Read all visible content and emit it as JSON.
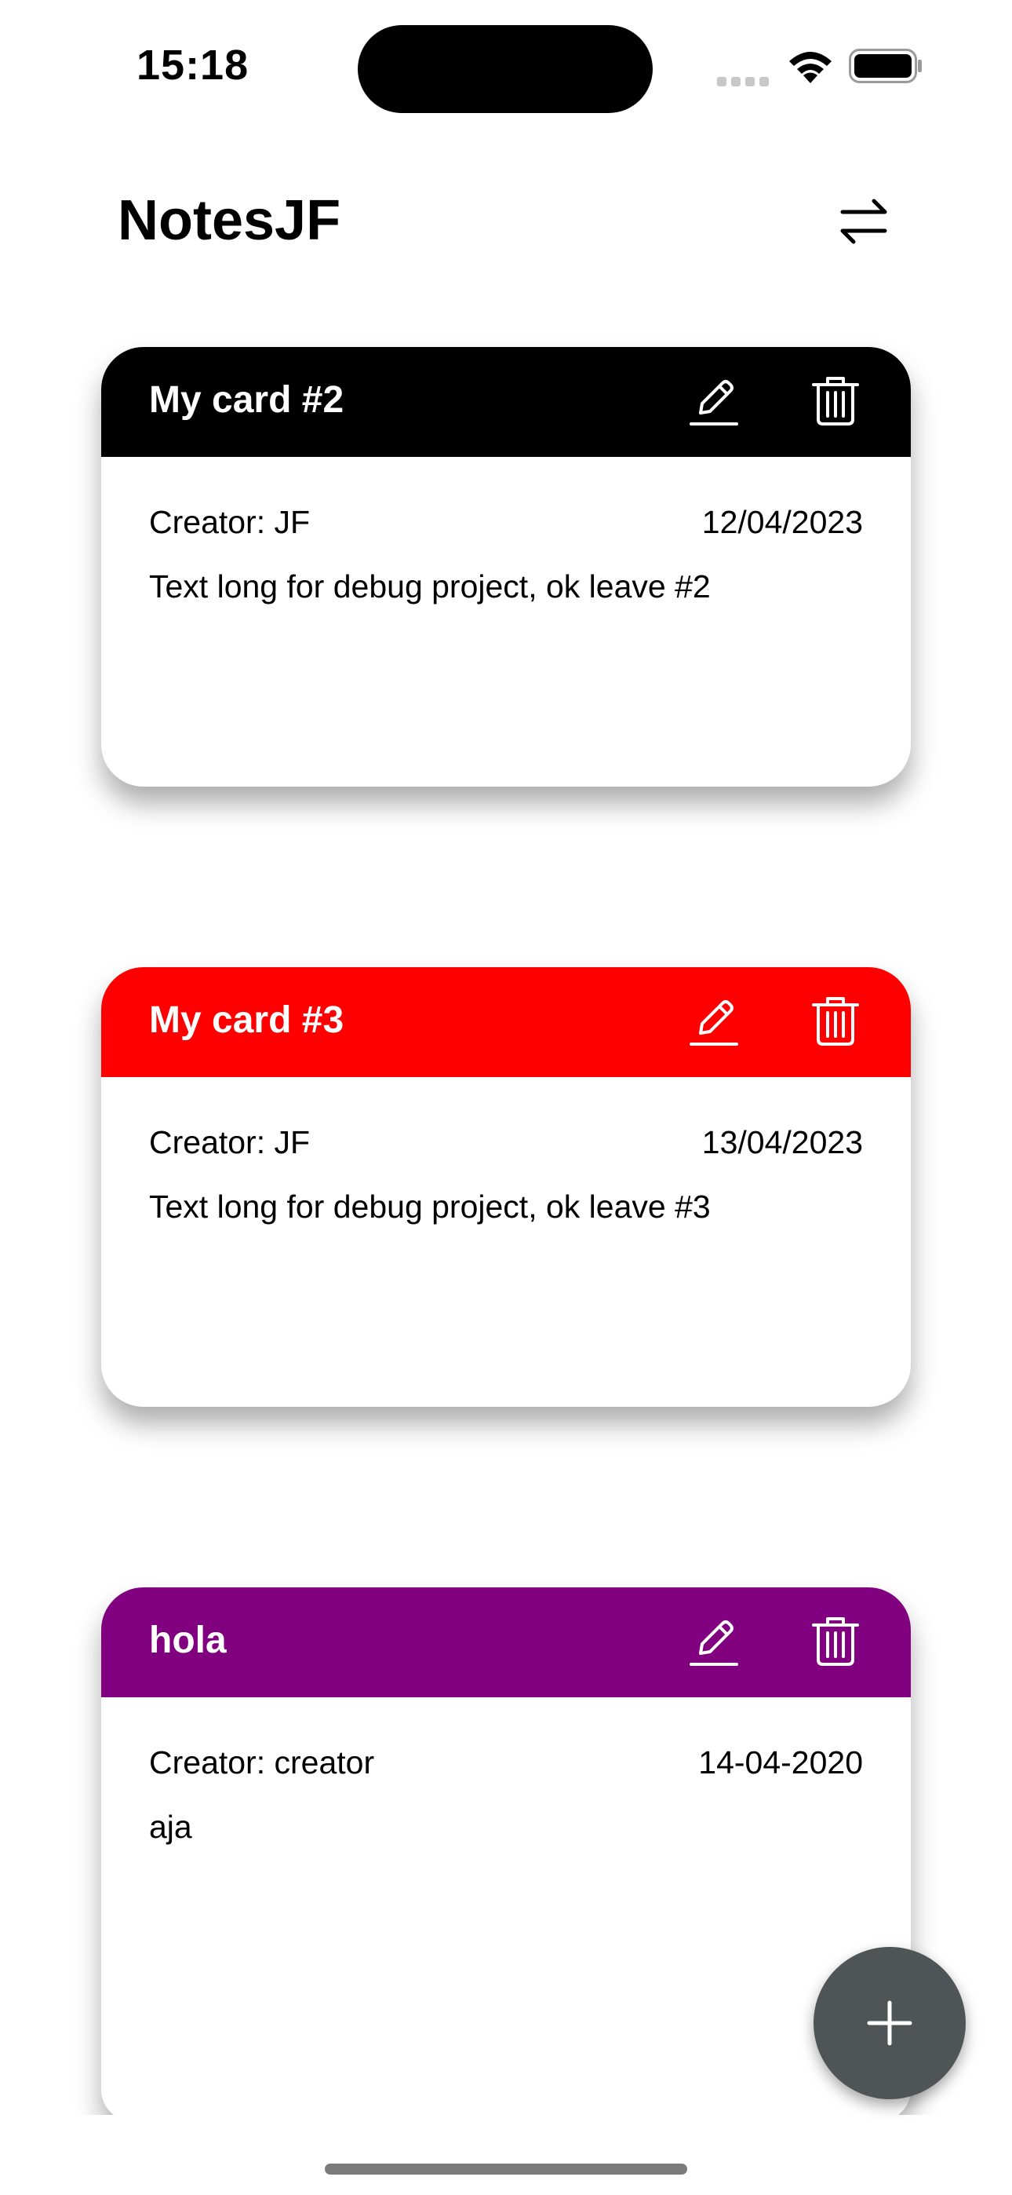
{
  "status_bar": {
    "time": "15:18"
  },
  "header": {
    "title": "NotesJF",
    "sort_icon": "swap-arrows-icon"
  },
  "colors": {
    "card_2": "#000000",
    "card_3": "#ff0000",
    "card_hola": "#800080",
    "fab": "#4f5556"
  },
  "cards": [
    {
      "title": "My card #2",
      "creator": "Creator: JF",
      "date": "12/04/2023",
      "text": "Text long for debug project, ok leave #2",
      "color": "#000000"
    },
    {
      "title": "My card #3",
      "creator": "Creator: JF",
      "date": "13/04/2023",
      "text": "Text long for debug project, ok leave #3",
      "color": "#ff0000"
    },
    {
      "title": "hola",
      "creator": "Creator: creator",
      "date": "14-04-2020",
      "text": "aja",
      "color": "#800080"
    }
  ],
  "fab": {
    "icon": "plus-icon"
  }
}
